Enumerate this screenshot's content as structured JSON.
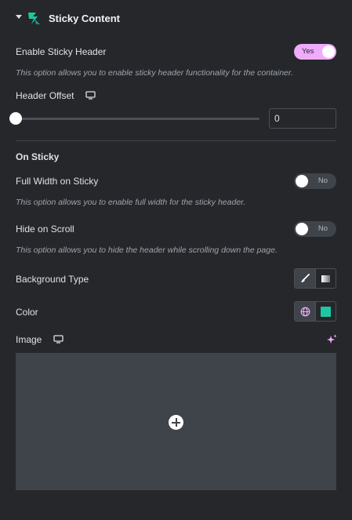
{
  "section": {
    "title": "Sticky Content"
  },
  "enable_sticky_header": {
    "label": "Enable Sticky Header",
    "toggle_text": "Yes",
    "state": "on",
    "description": "This option allows you to enable sticky header functionality for the container."
  },
  "header_offset": {
    "label": "Header Offset",
    "value": "0",
    "slider_fraction": 0
  },
  "on_sticky": {
    "heading": "On Sticky"
  },
  "full_width_on_sticky": {
    "label": "Full Width on Sticky",
    "toggle_text": "No",
    "state": "off",
    "description": "This option allows you to enable full width for the sticky header."
  },
  "hide_on_scroll": {
    "label": "Hide on Scroll",
    "toggle_text": "No",
    "state": "off",
    "description": "This option allows you to hide the header while scrolling down the page."
  },
  "background_type": {
    "label": "Background Type",
    "options": [
      "classic-brush-icon",
      "gradient-icon"
    ],
    "selected": "classic-brush-icon"
  },
  "color": {
    "label": "Color",
    "swatch": "#1ec7a4",
    "globe_color": "#f0abfc"
  },
  "image": {
    "label": "Image"
  },
  "colors": {
    "accent": "#f0abfc",
    "logo": "#1ec7a4",
    "background": "#26272b"
  }
}
